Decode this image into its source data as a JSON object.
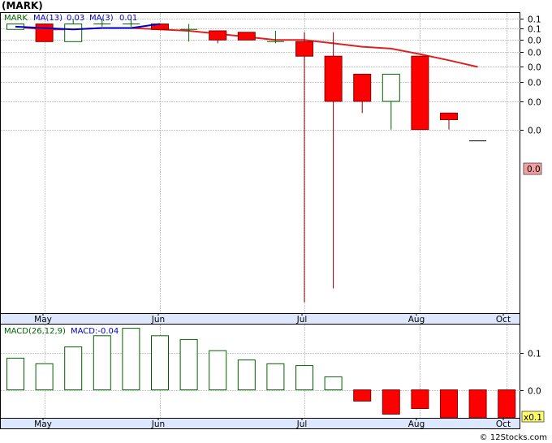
{
  "title": "(MARK)",
  "credit": "© 12Stocks.com",
  "colors": {
    "up": "#006400",
    "down_fill": "#ff0000",
    "down_wick": "#8b0000",
    "ma13": "#dd2222",
    "ma3": "#0000cc",
    "grid": "#b8b8b8",
    "axis_bg": "#dde8ff"
  },
  "chart_data": [
    {
      "type": "candlestick",
      "title": "",
      "legend": {
        "ticker": "MARK",
        "ma13_label": "MA(13)",
        "ma13_value": "0.03",
        "ma3_label": "MA(3)",
        "ma3_value": "0.01"
      },
      "y_scale": "log",
      "y_tick_labels": [
        "0.1",
        "0.1",
        "0.0",
        "0.0",
        "0.0",
        "0.0",
        "0.0",
        "0.0"
      ],
      "y_tick_values": [
        0.062,
        0.055,
        0.047,
        0.04,
        0.033,
        0.027,
        0.021,
        0.0145
      ],
      "ylim": [
        0.0013,
        0.067
      ],
      "last_price_label": "0.0",
      "last_price": 0.0125,
      "x_labels": [
        "May",
        "Jun",
        "Jul",
        "Aug",
        "Oct"
      ],
      "candles": [
        {
          "o": 0.054,
          "h": 0.058,
          "l": 0.054,
          "c": 0.058
        },
        {
          "o": 0.058,
          "h": 0.058,
          "l": 0.046,
          "c": 0.046
        },
        {
          "o": 0.046,
          "h": 0.062,
          "l": 0.046,
          "c": 0.058
        },
        {
          "o": 0.058,
          "h": 0.062,
          "l": 0.056,
          "c": 0.058
        },
        {
          "o": 0.058,
          "h": 0.062,
          "l": 0.056,
          "c": 0.058
        },
        {
          "o": 0.058,
          "h": 0.058,
          "l": 0.055,
          "c": 0.054
        },
        {
          "o": 0.054,
          "h": 0.058,
          "l": 0.046,
          "c": 0.054
        },
        {
          "o": 0.053,
          "h": 0.053,
          "l": 0.045,
          "c": 0.047
        },
        {
          "o": 0.052,
          "h": 0.052,
          "l": 0.047,
          "c": 0.047
        },
        {
          "o": 0.046,
          "h": 0.053,
          "l": 0.045,
          "c": 0.046
        },
        {
          "o": 0.046,
          "h": 0.052,
          "l": 0.0015,
          "c": 0.038
        },
        {
          "o": 0.038,
          "h": 0.052,
          "l": 0.0018,
          "c": 0.021
        },
        {
          "o": 0.03,
          "h": 0.03,
          "l": 0.018,
          "c": 0.021
        },
        {
          "o": 0.021,
          "h": 0.03,
          "l": 0.0145,
          "c": 0.03
        },
        {
          "o": 0.038,
          "h": 0.038,
          "l": 0.0145,
          "c": 0.0145
        },
        {
          "o": 0.018,
          "h": 0.018,
          "l": 0.0145,
          "c": 0.0165
        },
        {
          "o": 0.0125,
          "h": 0.0125,
          "l": 0.0125,
          "c": 0.0125
        }
      ],
      "ma13": [
        0.056,
        0.054,
        0.054,
        0.055,
        0.055,
        0.054,
        0.053,
        0.051,
        0.049,
        0.047,
        0.047,
        0.045,
        0.043,
        0.042,
        0.039,
        0.036,
        0.033
      ],
      "ma3": [
        0.056,
        0.055,
        0.054,
        0.055,
        0.055,
        0.058
      ]
    },
    {
      "type": "bar",
      "title": "",
      "legend": {
        "label": "MACD(26,12,9)",
        "value_label": "MACD:-0.04"
      },
      "y_tick_labels": [
        "0.1",
        "0.0"
      ],
      "y_tick_values": [
        0.1,
        0.0
      ],
      "ylim": [
        -0.075,
        0.175
      ],
      "multiplier_label": "x0.1",
      "x_labels": [
        "May",
        "Jun",
        "Jul",
        "Aug",
        "Oct"
      ],
      "values": [
        0.085,
        0.07,
        0.115,
        0.145,
        0.165,
        0.145,
        0.135,
        0.105,
        0.08,
        0.07,
        0.065,
        0.035,
        -0.03,
        -0.065,
        -0.05,
        -0.075,
        -0.075,
        -0.075
      ]
    }
  ]
}
